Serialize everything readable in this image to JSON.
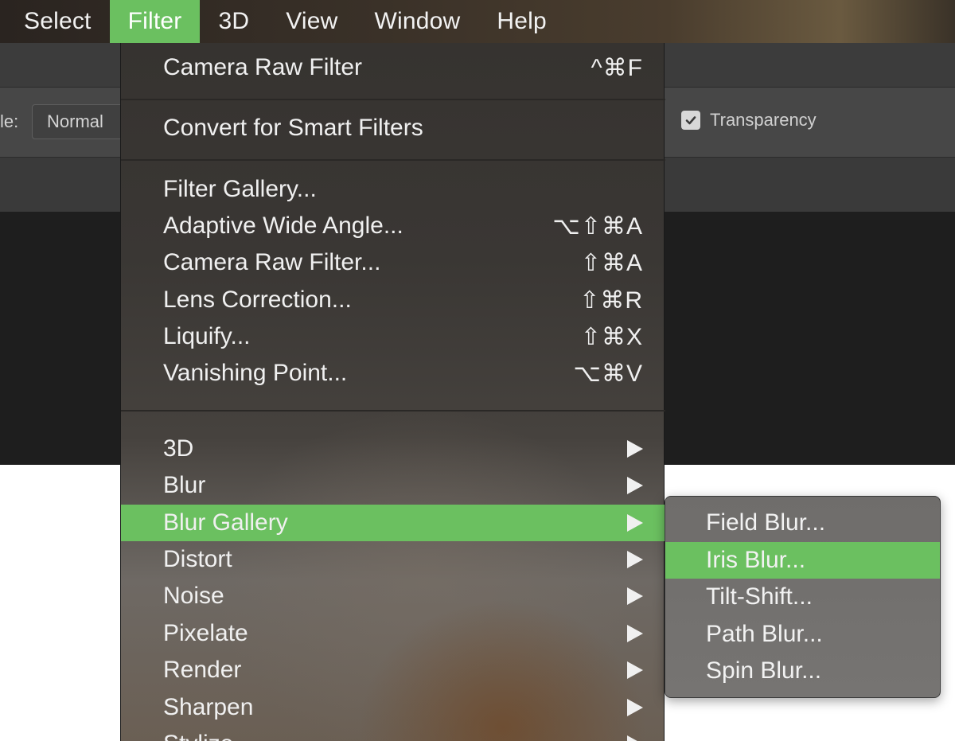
{
  "menubar": {
    "items": [
      {
        "label": "Select"
      },
      {
        "label": "Filter"
      },
      {
        "label": "3D"
      },
      {
        "label": "View"
      },
      {
        "label": "Window"
      },
      {
        "label": "Help"
      }
    ],
    "active_item": "Filter"
  },
  "options_bar": {
    "mode_label": "le:",
    "mode_value": "Normal",
    "transparency_label": "Transparency",
    "transparency_checked": true
  },
  "filter_menu": {
    "sections": [
      {
        "items": [
          {
            "label": "Camera Raw Filter",
            "shortcut": "^⌘F"
          }
        ]
      },
      {
        "items": [
          {
            "label": "Convert for Smart Filters",
            "shortcut": ""
          }
        ]
      },
      {
        "items": [
          {
            "label": "Filter Gallery...",
            "shortcut": ""
          },
          {
            "label": "Adaptive Wide Angle...",
            "shortcut": "⌥⇧⌘A"
          },
          {
            "label": "Camera Raw Filter...",
            "shortcut": "⇧⌘A"
          },
          {
            "label": "Lens Correction...",
            "shortcut": "⇧⌘R"
          },
          {
            "label": "Liquify...",
            "shortcut": "⇧⌘X"
          },
          {
            "label": "Vanishing Point...",
            "shortcut": "⌥⌘V"
          }
        ]
      },
      {
        "items": [
          {
            "label": "3D",
            "submenu": true
          },
          {
            "label": "Blur",
            "submenu": true
          },
          {
            "label": "Blur Gallery",
            "submenu": true,
            "highlighted": true
          },
          {
            "label": "Distort",
            "submenu": true
          },
          {
            "label": "Noise",
            "submenu": true
          },
          {
            "label": "Pixelate",
            "submenu": true
          },
          {
            "label": "Render",
            "submenu": true
          },
          {
            "label": "Sharpen",
            "submenu": true
          },
          {
            "label": "Stylize",
            "submenu": true
          }
        ]
      }
    ]
  },
  "blur_gallery_submenu": {
    "items": [
      {
        "label": "Field Blur..."
      },
      {
        "label": "Iris Blur...",
        "highlighted": true
      },
      {
        "label": "Tilt-Shift..."
      },
      {
        "label": "Path Blur..."
      },
      {
        "label": "Spin Blur..."
      }
    ]
  },
  "colors": {
    "highlight": "#6bc060",
    "menu_text": "#f0f0f0"
  }
}
